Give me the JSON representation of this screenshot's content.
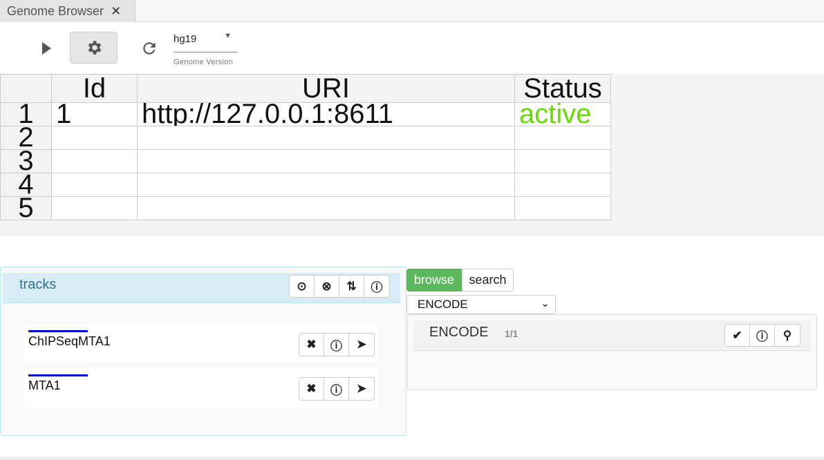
{
  "tab": {
    "title": "Genome Browser",
    "close": "✕"
  },
  "toolbar": {
    "run_icon": "play-icon",
    "settings_icon": "gear-icon",
    "refresh_icon": "refresh-icon",
    "genome_value": "hg19",
    "genome_label": "Genome Version"
  },
  "table": {
    "headers": [
      "Id",
      "URI",
      "Status"
    ],
    "row_numbers": [
      "1",
      "2",
      "3",
      "4",
      "5"
    ],
    "rows": [
      {
        "id": "1",
        "uri": "http://127.0.0.1:8611",
        "status": "active"
      },
      {
        "id": "",
        "uri": "",
        "status": ""
      },
      {
        "id": "",
        "uri": "",
        "status": ""
      },
      {
        "id": "",
        "uri": "",
        "status": ""
      },
      {
        "id": "",
        "uri": "",
        "status": ""
      }
    ],
    "status_color": "#66dd00"
  },
  "tracks": {
    "title": "tracks",
    "header_buttons": [
      "play-circle-icon",
      "x-circle-icon",
      "sort-icon",
      "info-icon"
    ],
    "items": [
      {
        "name": "ChIPSeqMTA1",
        "color": "#0000cc"
      },
      {
        "name": "MTA1",
        "color": "#0000cc"
      }
    ],
    "item_buttons": [
      "close-icon",
      "info-icon",
      "send-icon"
    ]
  },
  "browser": {
    "browse_label": "browse",
    "search_label": "search",
    "source_select": "ENCODE",
    "panel_title": "ENCODE",
    "panel_count": "1/1",
    "panel_buttons": [
      "check-circle-icon",
      "info-icon",
      "search-icon"
    ],
    "accent": "#5cb85c"
  }
}
